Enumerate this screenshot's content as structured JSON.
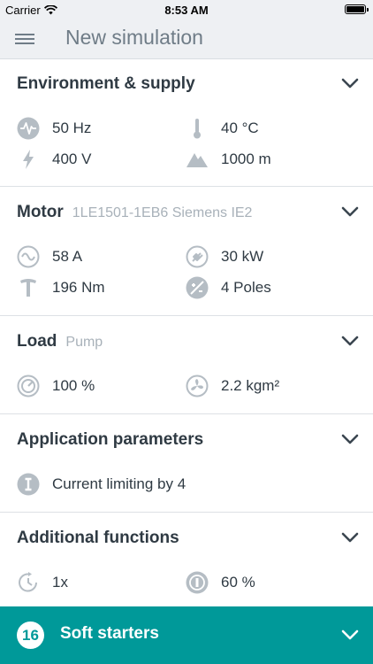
{
  "status_bar": {
    "carrier": "Carrier",
    "time": "8:53 AM"
  },
  "nav": {
    "title": "New simulation"
  },
  "sections": {
    "environment": {
      "title": "Environment & supply",
      "frequency": "50 Hz",
      "temperature": "40 °C",
      "voltage": "400 V",
      "altitude": "1000 m"
    },
    "motor": {
      "title": "Motor",
      "subtitle": "1LE1501-1EB6 Siemens IE2",
      "current": "58 A",
      "power": "30 kW",
      "torque": "196 Nm",
      "poles": "4 Poles"
    },
    "load": {
      "title": "Load",
      "subtitle": "Pump",
      "load_percent": "100 %",
      "inertia": "2.2 kgm²"
    },
    "application": {
      "title": "Application parameters",
      "current_limiting": "Current limiting by 4"
    },
    "additional": {
      "title": "Additional functions",
      "starts": "1x",
      "duty": "60 %"
    }
  },
  "footer": {
    "count": "16",
    "label": "Soft starters"
  },
  "colors": {
    "accent": "#009999",
    "text": "#2f3a43",
    "subtle": "#a8b1b9",
    "icon": "#b5bdc4"
  }
}
